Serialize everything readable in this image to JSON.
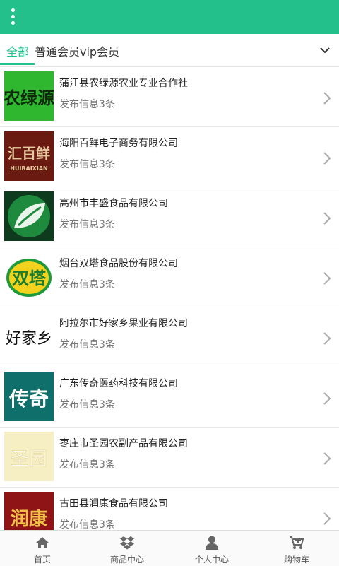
{
  "header": {
    "menu_icon": "more-vertical-icon",
    "bg_color": "#24c08c"
  },
  "tabs": {
    "items": [
      {
        "label": "全部",
        "active": true
      },
      {
        "label": "普通会员",
        "active": false
      },
      {
        "label": "vip会员",
        "active": false
      }
    ],
    "dropdown_icon": "chevron-down-icon"
  },
  "list": [
    {
      "name": "蒲江县农绿源农业专业合作社",
      "info": "发布信息3条",
      "logo_text": "农绿源"
    },
    {
      "name": "海阳百鲜电子商务有限公司",
      "info": "发布信息3条",
      "logo_text": "汇百鲜",
      "logo_subtext": "HUIBAIXIAN"
    },
    {
      "name": "高州市丰盛食品有限公司",
      "info": "发布信息3条",
      "logo_text": ""
    },
    {
      "name": "烟台双塔食品股份有限公司",
      "info": "发布信息3条",
      "logo_text": "双塔"
    },
    {
      "name": "阿拉尔市好家乡果业有限公司",
      "info": "发布信息3条",
      "logo_text": "好家乡"
    },
    {
      "name": "广东传奇医药科技有限公司",
      "info": "发布信息3条",
      "logo_text": "传奇"
    },
    {
      "name": "枣庄市圣园农副产品有限公司",
      "info": "发布信息3条",
      "logo_text": "圣园"
    },
    {
      "name": "古田县润康食品有限公司",
      "info": "发布信息3条",
      "logo_text": "润康"
    }
  ],
  "bottom_nav": [
    {
      "label": "首页",
      "icon": "home-icon"
    },
    {
      "label": "商品中心",
      "icon": "dropbox-icon"
    },
    {
      "label": "个人中心",
      "icon": "user-icon"
    },
    {
      "label": "购物车",
      "icon": "cart-icon"
    }
  ]
}
